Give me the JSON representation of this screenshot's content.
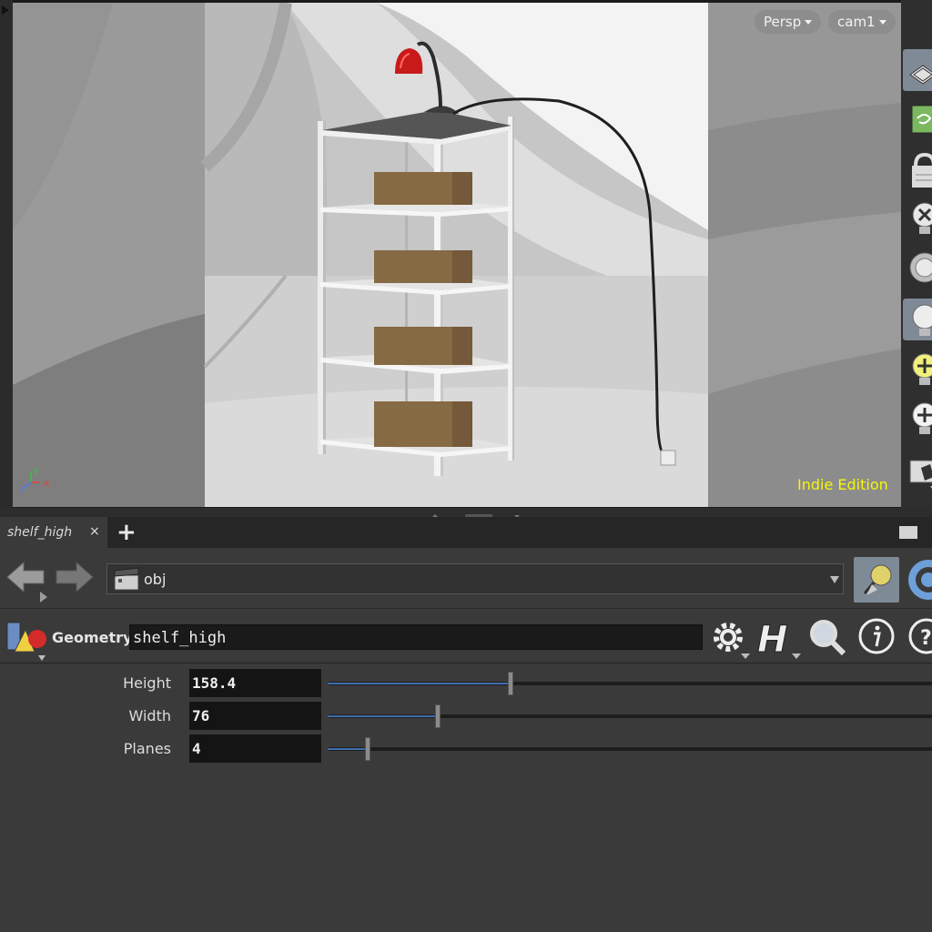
{
  "viewport": {
    "view_mode": "Persp",
    "camera": "cam1",
    "edition": "Indie Edition",
    "axis_x": "x",
    "axis_y": "y",
    "axis_z": "z"
  },
  "tools": [
    {
      "name": "display-options-icon",
      "selected": true
    },
    {
      "name": "rotate-view-icon",
      "selected": false
    },
    {
      "name": "lock-icon",
      "selected": false
    },
    {
      "name": "no-lights-icon",
      "selected": false
    },
    {
      "name": "headlight-icon",
      "selected": false
    },
    {
      "name": "normal-light-icon",
      "selected": true
    },
    {
      "name": "add-light-icon",
      "selected": false
    },
    {
      "name": "add-light-high-icon",
      "selected": false
    },
    {
      "name": "shading-icon",
      "selected": false
    }
  ],
  "tab": {
    "label": "shelf_high",
    "close": "×",
    "add": "+"
  },
  "path": {
    "value": "obj"
  },
  "node": {
    "type": "Geometry",
    "name": "shelf_high"
  },
  "params": [
    {
      "label": "Height",
      "value": "158.4",
      "fraction": 0.3
    },
    {
      "label": "Width",
      "value": "76",
      "fraction": 0.18
    },
    {
      "label": "Planes",
      "value": "4",
      "fraction": 0.065
    }
  ]
}
